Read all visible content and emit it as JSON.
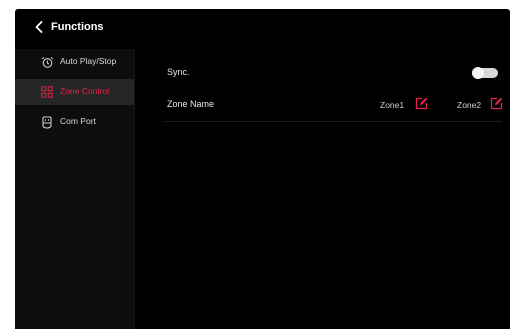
{
  "header": {
    "title": "Functions"
  },
  "sidebar": {
    "items": [
      {
        "label": "Auto Play/Stop",
        "icon": "alarm-clock-icon",
        "active": false
      },
      {
        "label": "Zone Control",
        "icon": "grid-icon",
        "active": true
      },
      {
        "label": "Com Port",
        "icon": "com-port-icon",
        "active": false
      }
    ]
  },
  "main": {
    "sync": {
      "label": "Sync.",
      "enabled": false
    },
    "zone_name": {
      "label": "Zone Name",
      "zones": [
        "Zone1",
        "Zone2"
      ]
    }
  },
  "colors": {
    "background": "#000000",
    "sidebar_bg": "#0d0d0d",
    "active_bg": "#262626",
    "accent": "#e0244a",
    "text": "#e8e8e8"
  }
}
